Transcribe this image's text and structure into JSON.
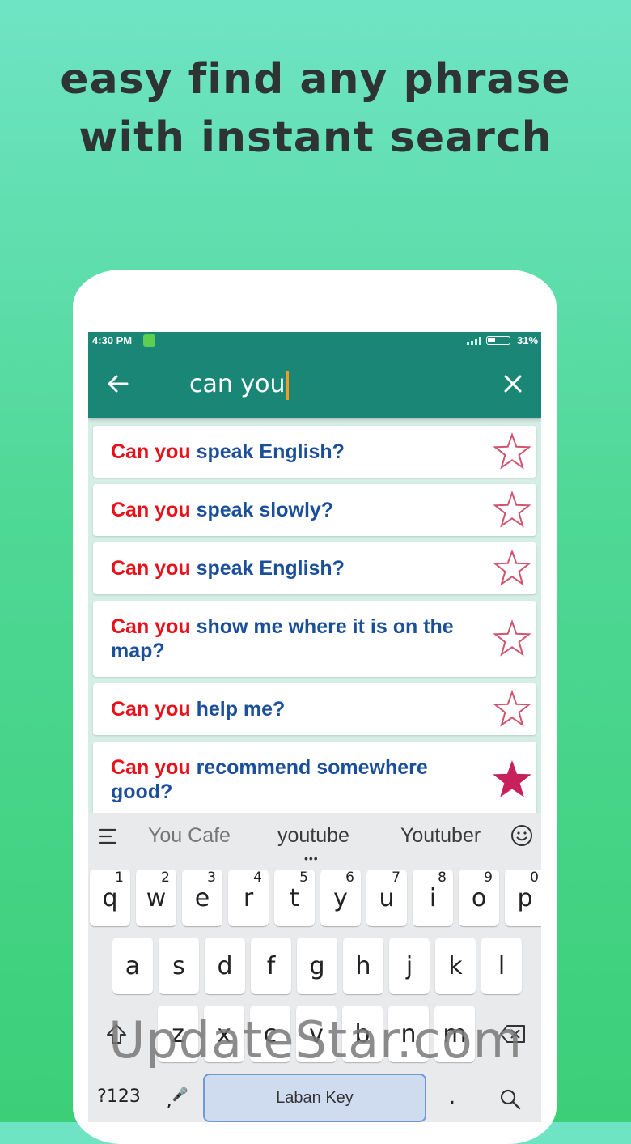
{
  "headline": {
    "line1": "easy find any phrase",
    "line2": "with instant search"
  },
  "status_bar": {
    "time": "4:30 PM",
    "battery": "31%"
  },
  "search": {
    "query": "can you"
  },
  "results": [
    {
      "highlight": "Can you",
      "rest": " speak English?",
      "favorited": false
    },
    {
      "highlight": "Can you",
      "rest": " speak slowly?",
      "favorited": false
    },
    {
      "highlight": "Can you",
      "rest": " speak English?",
      "favorited": false
    },
    {
      "highlight": "Can you",
      "rest": " show me where it is on the map?",
      "favorited": false
    },
    {
      "highlight": "Can you",
      "rest": " help me?",
      "favorited": false
    },
    {
      "highlight": "Can you",
      "rest": " recommend somewhere good?",
      "favorited": true
    }
  ],
  "keyboard": {
    "suggestions": [
      "You Cafe",
      "youtube",
      "Youtuber"
    ],
    "row1": [
      {
        "key": "q",
        "num": "1"
      },
      {
        "key": "w",
        "num": "2"
      },
      {
        "key": "e",
        "num": "3"
      },
      {
        "key": "r",
        "num": "4"
      },
      {
        "key": "t",
        "num": "5"
      },
      {
        "key": "y",
        "num": "6"
      },
      {
        "key": "u",
        "num": "7"
      },
      {
        "key": "i",
        "num": "8"
      },
      {
        "key": "o",
        "num": "9"
      },
      {
        "key": "p",
        "num": "0"
      }
    ],
    "row2": [
      "a",
      "s",
      "d",
      "f",
      "g",
      "h",
      "j",
      "k",
      "l"
    ],
    "row3": [
      "z",
      "x",
      "c",
      "v",
      "b",
      "n",
      "m"
    ],
    "symbols_label": "?123",
    "comma_label": ",",
    "space_label": "Laban Key",
    "period_label": "."
  },
  "watermark": "UpdateStar.com",
  "colors": {
    "toolbar": "#1a8676",
    "highlight": "#e8101a",
    "phrase": "#1c4f9a",
    "star": "#c8205a",
    "caret": "#f39a22"
  }
}
